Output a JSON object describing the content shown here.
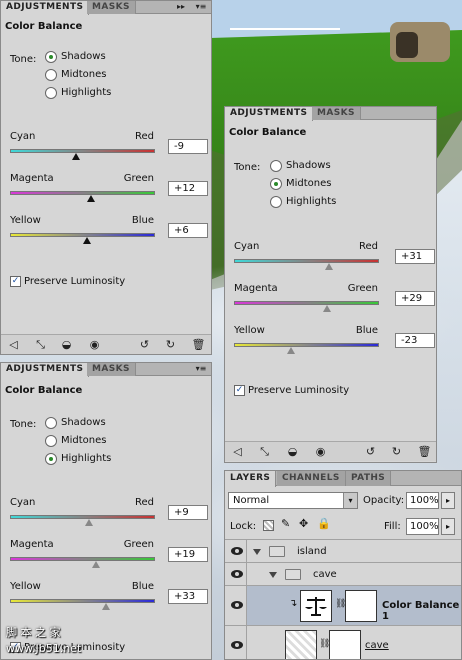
{
  "colors": {
    "panel": "#d6d6d6",
    "accent_green": "#2a8a2a",
    "selected_row": "#b3bdcc"
  },
  "panels": [
    {
      "tabs": [
        "ADJUSTMENTS",
        "MASKS"
      ],
      "title": "Color Balance",
      "tone_label": "Tone:",
      "tones": [
        "Shadows",
        "Midtones",
        "Highlights"
      ],
      "selected_tone": "Shadows",
      "sliders": [
        {
          "left": "Cyan",
          "right": "Red",
          "value": "-9"
        },
        {
          "left": "Magenta",
          "right": "Green",
          "value": "+12"
        },
        {
          "left": "Yellow",
          "right": "Blue",
          "value": "+6"
        }
      ],
      "preserve_label": "Preserve Luminosity",
      "preserve_checked": true
    },
    {
      "tabs": [
        "ADJUSTMENTS",
        "MASKS"
      ],
      "title": "Color Balance",
      "tone_label": "Tone:",
      "tones": [
        "Shadows",
        "Midtones",
        "Highlights"
      ],
      "selected_tone": "Midtones",
      "sliders": [
        {
          "left": "Cyan",
          "right": "Red",
          "value": "+31"
        },
        {
          "left": "Magenta",
          "right": "Green",
          "value": "+29"
        },
        {
          "left": "Yellow",
          "right": "Blue",
          "value": "-23"
        }
      ],
      "preserve_label": "Preserve Luminosity",
      "preserve_checked": true
    },
    {
      "tabs": [
        "ADJUSTMENTS",
        "MASKS"
      ],
      "title": "Color Balance",
      "tone_label": "Tone:",
      "tones": [
        "Shadows",
        "Midtones",
        "Highlights"
      ],
      "selected_tone": "Highlights",
      "sliders": [
        {
          "left": "Cyan",
          "right": "Red",
          "value": "+9"
        },
        {
          "left": "Magenta",
          "right": "Green",
          "value": "+19"
        },
        {
          "left": "Yellow",
          "right": "Blue",
          "value": "+33"
        }
      ],
      "preserve_label": "Preserve Luminosity",
      "preserve_checked": true
    }
  ],
  "toolbar_icons": [
    "back-arrow-icon",
    "expand-view-icon",
    "clip-layer-icon",
    "eye-icon",
    "previous-state-icon",
    "reset-icon",
    "trash-icon"
  ],
  "layers": {
    "tabs": [
      "LAYERS",
      "CHANNELS",
      "PATHS"
    ],
    "blend_mode": "Normal",
    "opacity_label": "Opacity:",
    "opacity": "100%",
    "lock_label": "Lock:",
    "fill_label": "Fill:",
    "fill": "100%",
    "rows": [
      {
        "name": "island",
        "type": "group"
      },
      {
        "name": "cave",
        "type": "group"
      },
      {
        "name": "Color Balance 1",
        "type": "adjustment"
      },
      {
        "name": "cave",
        "type": "layer"
      }
    ]
  },
  "watermark": {
    "line1": "脚 本 之 家",
    "line2": "www.Jb51.net"
  }
}
